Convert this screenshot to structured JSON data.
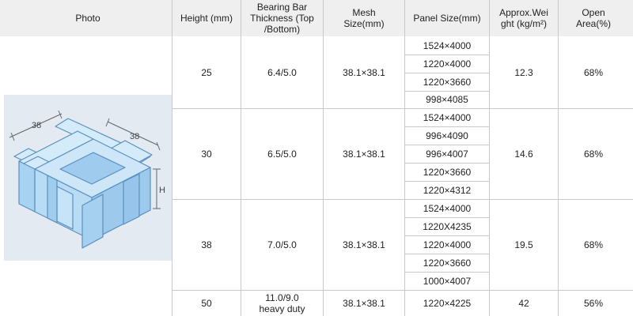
{
  "headers": {
    "photo": "Photo",
    "height": "Height (mm)",
    "bearing_bar": "Bearing Bar Thickness (Top /Bottom)",
    "mesh": "Mesh Size(mm)",
    "panel": "Panel Size(mm)",
    "weight": "Approx.Wei ght (kg/m²)",
    "open_area": "Open Area(%)"
  },
  "diagram": {
    "dim_left": "38",
    "dim_right": "38",
    "dim_height": "H",
    "colors": {
      "fill": "#b9dcf5",
      "stroke": "#5a8fbf"
    }
  },
  "rows": [
    {
      "height": "25",
      "thickness": "6.4/5.0",
      "mesh": "38.1×38.1",
      "panels": [
        "1524×4000",
        "1220×4000",
        "1220×3660",
        "998×4085"
      ],
      "weight": "12.3",
      "open": "68%"
    },
    {
      "height": "30",
      "thickness": "6.5/5.0",
      "mesh": "38.1×38.1",
      "panels": [
        "1524×4000",
        "996×4090",
        "996×4007",
        "1220×3660",
        "1220×4312"
      ],
      "weight": "14.6",
      "open": "68%"
    },
    {
      "height": "38",
      "thickness": "7.0/5.0",
      "mesh": "38.1×38.1",
      "panels": [
        "1524×4000",
        "1220X4235",
        "1220×4000",
        "1220×3660",
        "1000×4007"
      ],
      "weight": "19.5",
      "open": "68%"
    },
    {
      "height": "50",
      "thickness": "11.0/9.0",
      "thickness_note": "heavy duty",
      "mesh": "38.1×38.1",
      "panels": [
        "1220×4225"
      ],
      "weight": "42",
      "open": "56%"
    }
  ]
}
